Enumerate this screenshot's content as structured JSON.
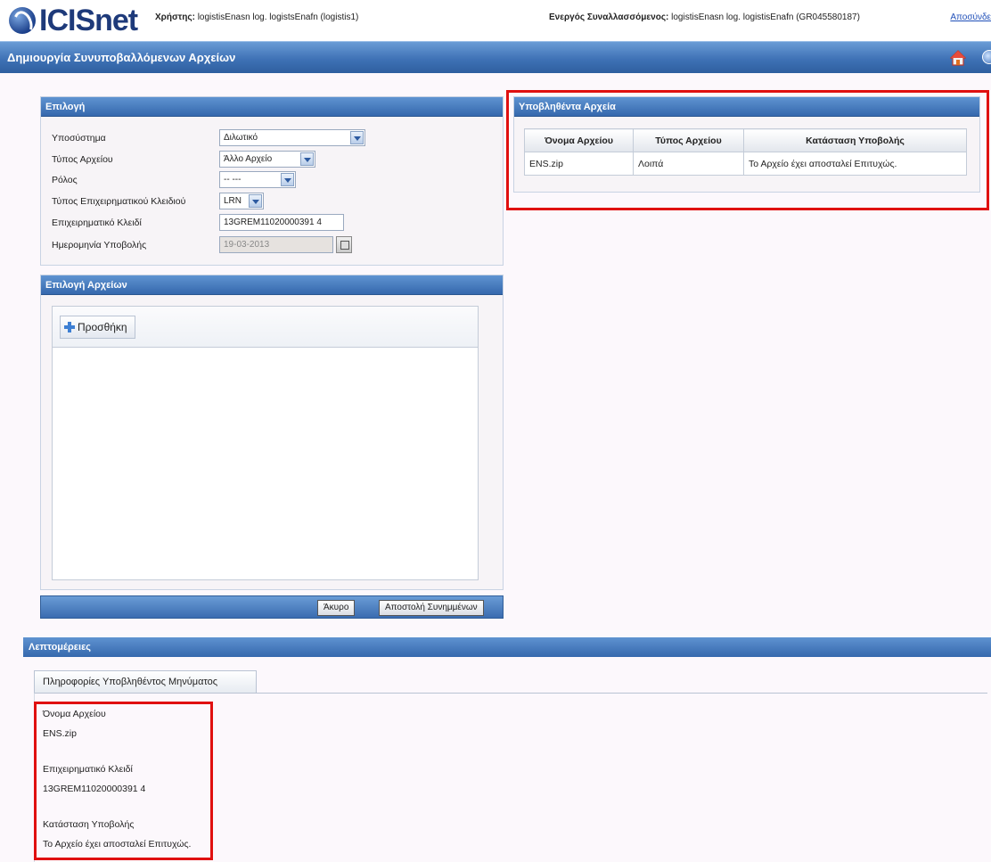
{
  "header": {
    "logo_text": "ICISnet",
    "user_label": "Χρήστης:",
    "user_value": "logistisEnasn log. logistsEnafn (logistis1)",
    "active_label": "Ενεργός Συναλλασσόμενος:",
    "active_value": "logistisEnasn log. logistisEnafn (GR045580187)",
    "logout_label": "Αποσύνδε"
  },
  "titlebar": {
    "title": "Δημιουργία Συνυποβαλλόμενων Αρχείων"
  },
  "selection": {
    "title": "Επιλογή",
    "subsystem_label": "Υποσύστημα",
    "subsystem_value": "Διλωτικό",
    "file_type_label": "Τύπος Αρχείου",
    "file_type_value": "Άλλο Αρχείο",
    "role_label": "Ρόλος",
    "role_value": "-- ---",
    "key_type_label": "Τύπος Επιχειρηματικού Κλειδιού",
    "key_type_value": "LRN",
    "business_key_label": "Επιχειρηματικό Κλειδί",
    "business_key_value": "13GREM11020000391 4",
    "date_label": "Ημερομηνία Υποβολής",
    "date_value": "19-03-2013"
  },
  "file_select": {
    "title": "Επιλογή Αρχείων",
    "add_label": "Προσθήκη"
  },
  "actions": {
    "cancel_label": "Άκυρο",
    "send_label": "Αποστολή Συνημμένων"
  },
  "submitted": {
    "title": "Υποβληθέντα Αρχεία",
    "columns": [
      "Όνομα Αρχείου",
      "Τύπος Αρχείου",
      "Κατάσταση Υποβολής"
    ],
    "rows": [
      [
        "ENS.zip",
        "Λοιπά",
        "Το Αρχείο έχει αποσταλεί Επιτυχώς."
      ]
    ]
  },
  "details": {
    "title": "Λεπτομέρειες",
    "tab_label": "Πληροφορίες Υποβληθέντος Μηνύματος",
    "file_name_label": "Όνομα Αρχείου",
    "file_name_value": "ENS.zip",
    "business_key_label": "Επιχειρηματικό Κλειδί",
    "business_key_value": "13GREM11020000391 4",
    "status_label": "Κατάσταση Υποβολής",
    "status_value": "Το Αρχείο έχει αποσταλεί Επιτυχώς."
  },
  "colors": {
    "accent": "#3568ad",
    "highlight": "#e01010"
  }
}
